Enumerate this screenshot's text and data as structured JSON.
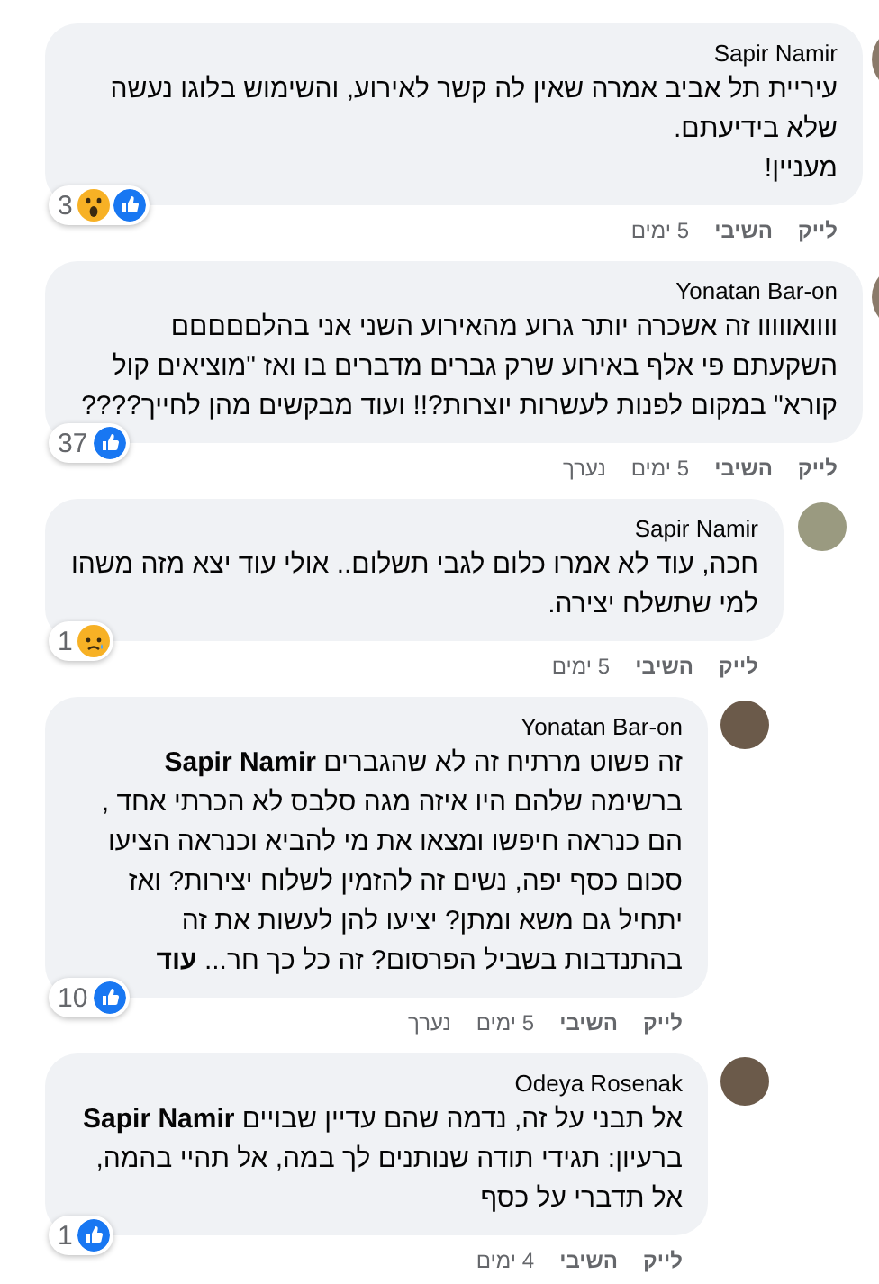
{
  "comments": [
    {
      "author": "Sapir Namir",
      "text": "עיריית תל אביב אמרה שאין לה קשר לאירוע, והשימוש בלוגו נעשה שלא בידיעתם.\nמעניין!",
      "reactions": {
        "count": "3",
        "icons": [
          {
            "kind": "wow"
          },
          {
            "kind": "like"
          }
        ]
      },
      "actions": {
        "like": "לייק",
        "reply": "השיבי",
        "time": "5 ימים"
      }
    },
    {
      "author": "Yonatan Bar-on",
      "text": "וווואווווו זה אשכרה יותר גרוע מהאירוע השני אני בהלםםםםם השקעתם פי אלף באירוע שרק גברים מדברים בו ואז \"מוציאים קול קורא\" במקום לפנות לעשרות יוצרות?!! ועוד מבקשים מהן לחייך????",
      "reactions": {
        "count": "37",
        "icons": [
          {
            "kind": "like"
          }
        ]
      },
      "actions": {
        "like": "לייק",
        "reply": "השיבי",
        "time": "5 ימים",
        "edited": "נערך"
      },
      "children": [
        {
          "author": "Sapir Namir",
          "text": "חכה, עוד לא אמרו כלום לגבי תשלום.. אולי עוד יצא מזה משהו למי שתשלח יצירה.",
          "reactions": {
            "count": "1",
            "icons": [
              {
                "kind": "sad"
              }
            ]
          },
          "actions": {
            "like": "לייק",
            "reply": "השיבי",
            "time": "5 ימים"
          },
          "children": [
            {
              "author": "Yonatan Bar-on",
              "text": "**Sapir Namir** זה פשוט מרתיח זה לא שהגברים ברשימה שלהם היו איזה מגה סלבס לא הכרתי אחד , הם כנראה חיפשו ומצאו את מי להביא וכנראה הציעו סכום כסף יפה, נשים זה להזמין לשלוח יצירות? ואז יתחיל גם משא ומתן? יציעו להן לעשות את זה בהתנדבות בשביל הפרסום? זה כל כך חר...",
              "more": "עוד",
              "reactions": {
                "count": "10",
                "icons": [
                  {
                    "kind": "like"
                  }
                ]
              },
              "actions": {
                "like": "לייק",
                "reply": "השיבי",
                "time": "5 ימים",
                "edited": "נערך"
              }
            },
            {
              "author": "Odeya Rosenak",
              "text": "**Sapir Namir** אל תבני על זה, נדמה שהם עדיין שבויים ברעיון: תגידי תודה שנותנים לך במה, אל תהיי בהמה, אל תדברי על כסף",
              "reactions": {
                "count": "1",
                "icons": [
                  {
                    "kind": "like"
                  }
                ]
              },
              "actions": {
                "like": "לייק",
                "reply": "השיבי",
                "time": "4 ימים"
              }
            }
          ]
        }
      ]
    }
  ]
}
